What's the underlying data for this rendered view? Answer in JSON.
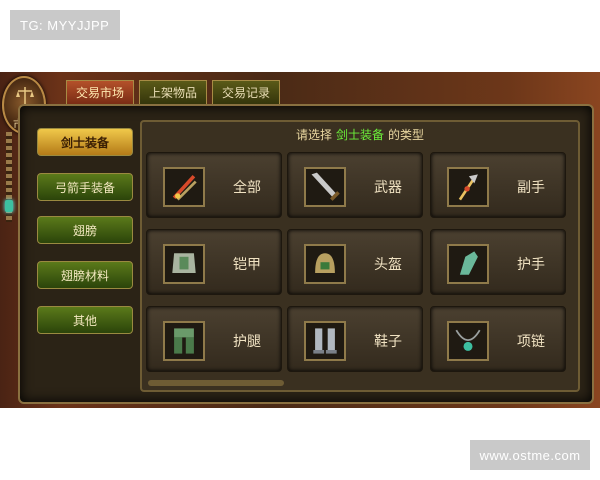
{
  "watermarks": {
    "top_left": "TG: MYYJJPP",
    "bottom_right": "www.ostme.com"
  },
  "emblem": {
    "label": "市场"
  },
  "tabs": [
    {
      "label": "交易市场",
      "active": true
    },
    {
      "label": "上架物品",
      "active": false
    },
    {
      "label": "交易记录",
      "active": false
    }
  ],
  "sidebar": {
    "items": [
      {
        "label": "剑士装备",
        "active": true
      },
      {
        "label": "弓箭手装备",
        "active": false
      },
      {
        "label": "翅膀",
        "active": false
      },
      {
        "label": "翅膀材料",
        "active": false
      },
      {
        "label": "其他",
        "active": false
      }
    ]
  },
  "header": {
    "prefix": "请选择",
    "highlight": "剑士装备",
    "suffix": "的类型"
  },
  "categories": [
    {
      "label": "全部",
      "icon": "sword-bundle-icon"
    },
    {
      "label": "武器",
      "icon": "greatsword-icon"
    },
    {
      "label": "副手",
      "icon": "trident-icon"
    },
    {
      "label": "铠甲",
      "icon": "armor-icon"
    },
    {
      "label": "头盔",
      "icon": "helmet-icon"
    },
    {
      "label": "护手",
      "icon": "gauntlet-icon"
    },
    {
      "label": "护腿",
      "icon": "leg-armor-icon"
    },
    {
      "label": "鞋子",
      "icon": "boots-icon"
    },
    {
      "label": "项链",
      "icon": "necklace-icon"
    }
  ],
  "colors": {
    "accent_gold": "#f0c84a",
    "accent_green": "#6cf03a",
    "tab_active": "#b4512a"
  }
}
